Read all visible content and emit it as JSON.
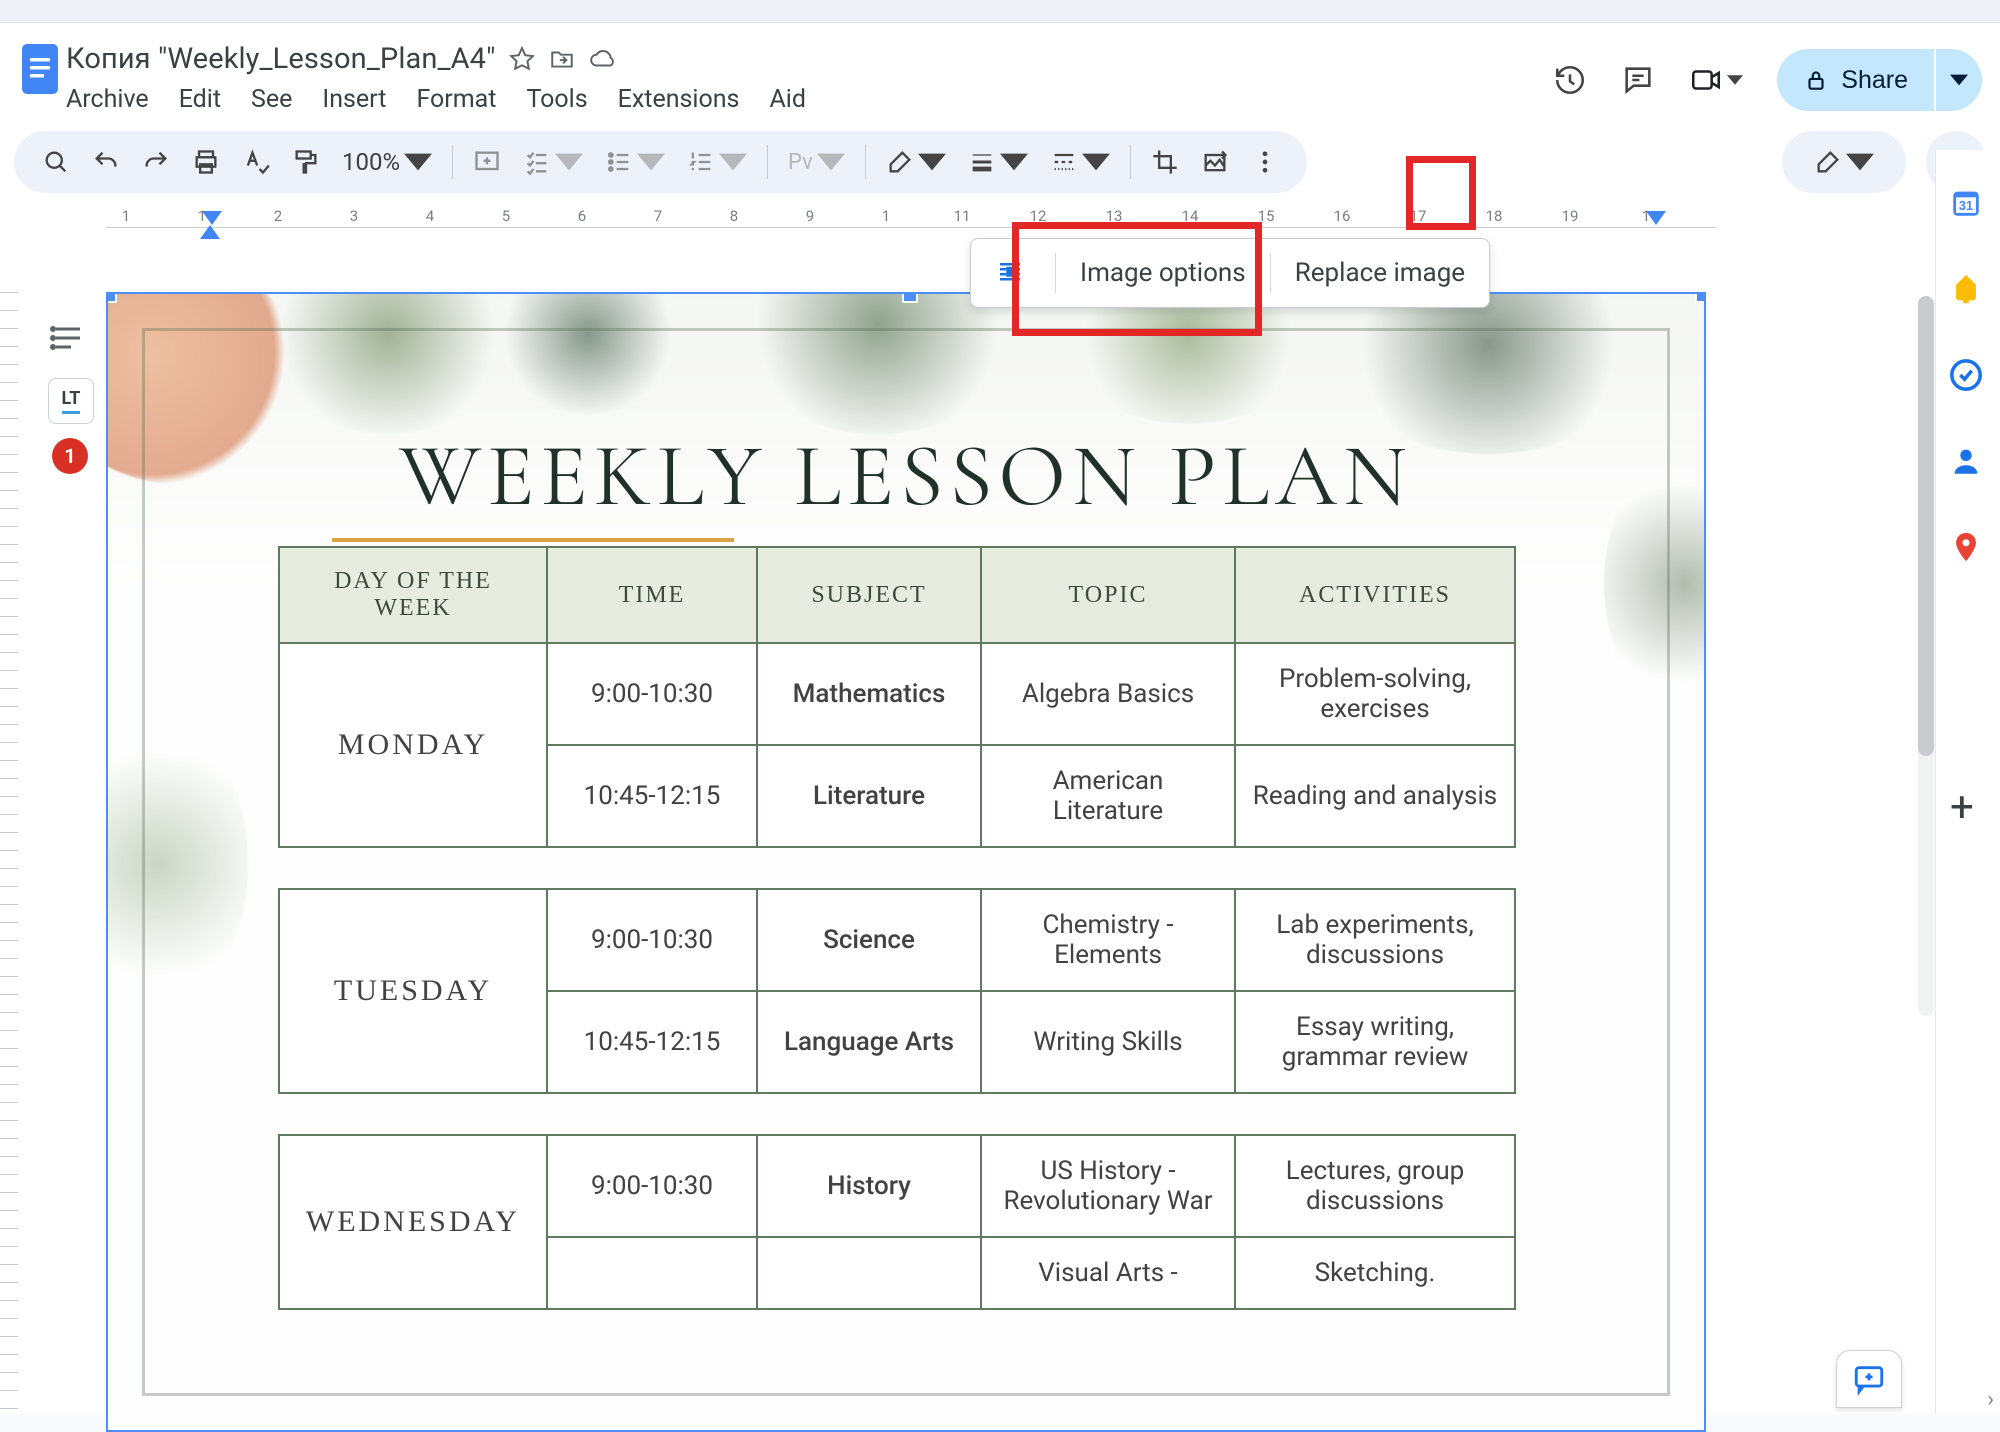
{
  "doc_title": "Копия \"Weekly_Lesson_Plan_A4\"",
  "menus": {
    "archive": "Archive",
    "edit": "Edit",
    "see": "See",
    "insert": "Insert",
    "format": "Format",
    "tools": "Tools",
    "extensions": "Extensions",
    "aid": "Aid"
  },
  "share_label": "Share",
  "toolbar": {
    "zoom": "100%",
    "image_options_label": "Image options",
    "replace_image_label": "Replace image"
  },
  "ruler": [
    "1",
    "1",
    "2",
    "3",
    "4",
    "5",
    "6",
    "7",
    "8",
    "9",
    "1",
    "11",
    "12",
    "13",
    "14",
    "15",
    "16",
    "17",
    "18",
    "19",
    "1"
  ],
  "lt_badge": "1",
  "lt_label": "LT",
  "plan": {
    "title": "WEEKLY LESSON PLAN",
    "headers": {
      "day": "DAY OF THE WEEK",
      "time": "TIME",
      "subject": "SUBJECT",
      "topic": "TOPIC",
      "activities": "ACTIVITIES"
    },
    "days": [
      {
        "day": "MONDAY",
        "rows": [
          {
            "time": "9:00-10:30",
            "subject": "Mathematics",
            "topic": "Algebra Basics",
            "activities": "Problem-solving, exercises"
          },
          {
            "time": "10:45-12:15",
            "subject": "Literature",
            "topic": "American Literature",
            "activities": "Reading and analysis"
          }
        ]
      },
      {
        "day": "TUESDAY",
        "rows": [
          {
            "time": "9:00-10:30",
            "subject": "Science",
            "topic": "Chemistry - Elements",
            "activities": "Lab experiments, discussions"
          },
          {
            "time": "10:45-12:15",
            "subject": "Language Arts",
            "topic": "Writing Skills",
            "activities": "Essay writing, grammar review"
          }
        ]
      },
      {
        "day": "WEDNESDAY",
        "rows": [
          {
            "time": "9:00-10:30",
            "subject": "History",
            "topic": "US History - Revolutionary War",
            "activities": "Lectures, group discussions"
          },
          {
            "time": "",
            "subject": "",
            "topic": "Visual Arts -",
            "activities": "Sketching."
          }
        ]
      }
    ]
  }
}
